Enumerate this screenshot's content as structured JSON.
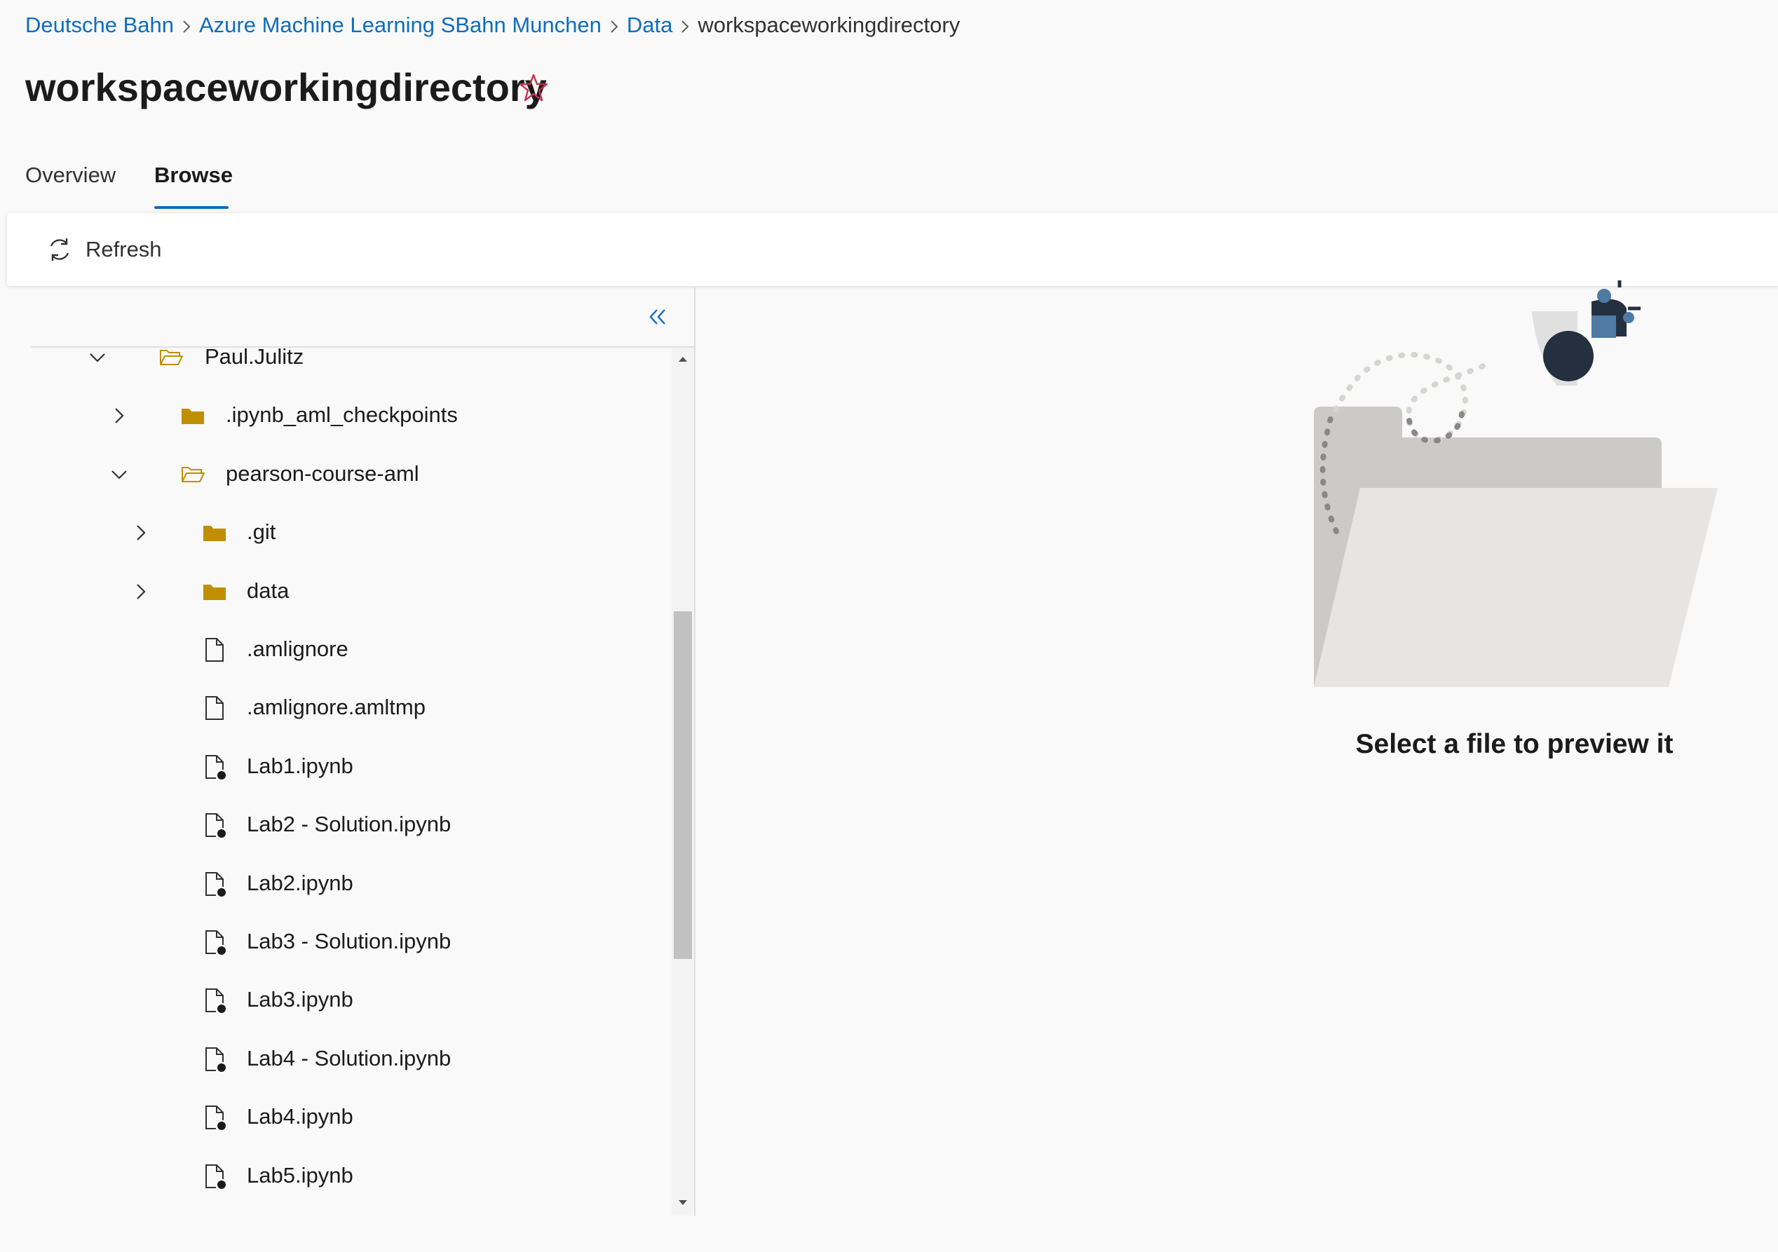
{
  "breadcrumb": {
    "items": [
      "Deutsche Bahn",
      "Azure Machine Learning SBahn Munchen",
      "Data"
    ],
    "current": "workspaceworkingdirectory"
  },
  "page": {
    "title": "workspaceworkingdirectory"
  },
  "tabs": [
    "Overview",
    "Browse"
  ],
  "active_tab": "Browse",
  "toolbar": {
    "refresh_label": "Refresh"
  },
  "tree": {
    "items": [
      {
        "label": "Paul.Julitz",
        "type": "folder-open",
        "expanded": true,
        "level": 0
      },
      {
        "label": ".ipynb_aml_checkpoints",
        "type": "folder",
        "expanded": false,
        "level": 1
      },
      {
        "label": "pearson-course-aml",
        "type": "folder-open",
        "expanded": true,
        "level": 1
      },
      {
        "label": ".git",
        "type": "folder",
        "expanded": false,
        "level": 2
      },
      {
        "label": "data",
        "type": "folder",
        "expanded": false,
        "level": 2
      },
      {
        "label": ".amlignore",
        "type": "file",
        "level": 2
      },
      {
        "label": ".amlignore.amltmp",
        "type": "file",
        "level": 2
      },
      {
        "label": "Lab1.ipynb",
        "type": "notebook",
        "level": 2
      },
      {
        "label": "Lab2 - Solution.ipynb",
        "type": "notebook",
        "level": 2
      },
      {
        "label": "Lab2.ipynb",
        "type": "notebook",
        "level": 2
      },
      {
        "label": "Lab3 - Solution.ipynb",
        "type": "notebook",
        "level": 2
      },
      {
        "label": "Lab3.ipynb",
        "type": "notebook",
        "level": 2
      },
      {
        "label": "Lab4 - Solution.ipynb",
        "type": "notebook",
        "level": 2
      },
      {
        "label": "Lab4.ipynb",
        "type": "notebook",
        "level": 2
      },
      {
        "label": "Lab5.ipynb",
        "type": "notebook",
        "level": 2
      }
    ]
  },
  "preview": {
    "message": "Select a file to preview it"
  },
  "icons": {
    "favorite": "star-outline-icon",
    "refresh": "refresh-icon",
    "collapse": "double-chevron-left-icon",
    "folder_open": "folder-open-outline-icon",
    "folder_closed": "folder-filled-icon",
    "file": "file-icon",
    "notebook": "notebook-file-icon"
  },
  "colors": {
    "link": "#0f6cbd",
    "accent": "#0f6cbd",
    "folder": "#bf8f00",
    "star": "#c4314b",
    "background": "#f9f9f9"
  }
}
